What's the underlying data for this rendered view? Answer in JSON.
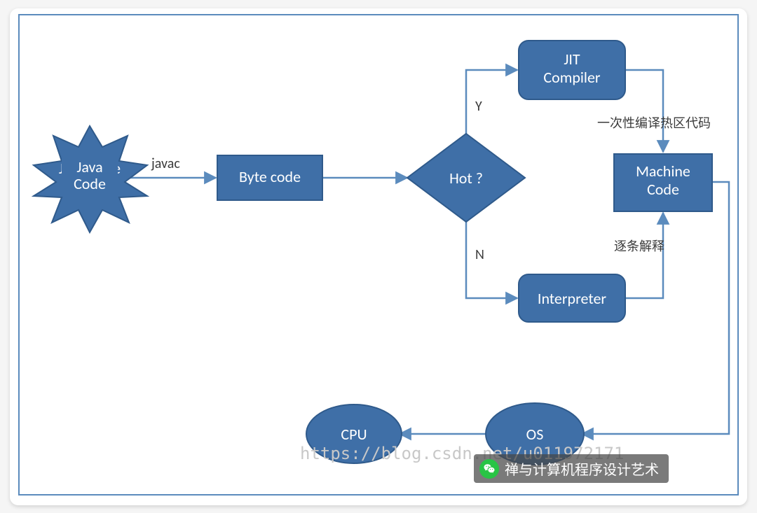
{
  "nodes": {
    "javaCode": "Java Code",
    "byteCode": "Byte code",
    "hot": "Hot ?",
    "jit1": "JIT",
    "jit2": "Compiler",
    "interpreter": "Interpreter",
    "machine1": "Machine",
    "machine2": "Code",
    "os": "OS",
    "cpu": "CPU"
  },
  "labels": {
    "javac": "javac",
    "yes": "Y",
    "no": "N",
    "compilePath": "一次性编译热区代码",
    "interpretPath": "逐条解释"
  },
  "watermark": "https://blog.csdn.net/u011972171",
  "footer": "禅与计算机程序设计艺术",
  "colors": {
    "fill": "#3f6fa7",
    "stroke": "#2f5a8b",
    "line": "#5b8bbd"
  }
}
